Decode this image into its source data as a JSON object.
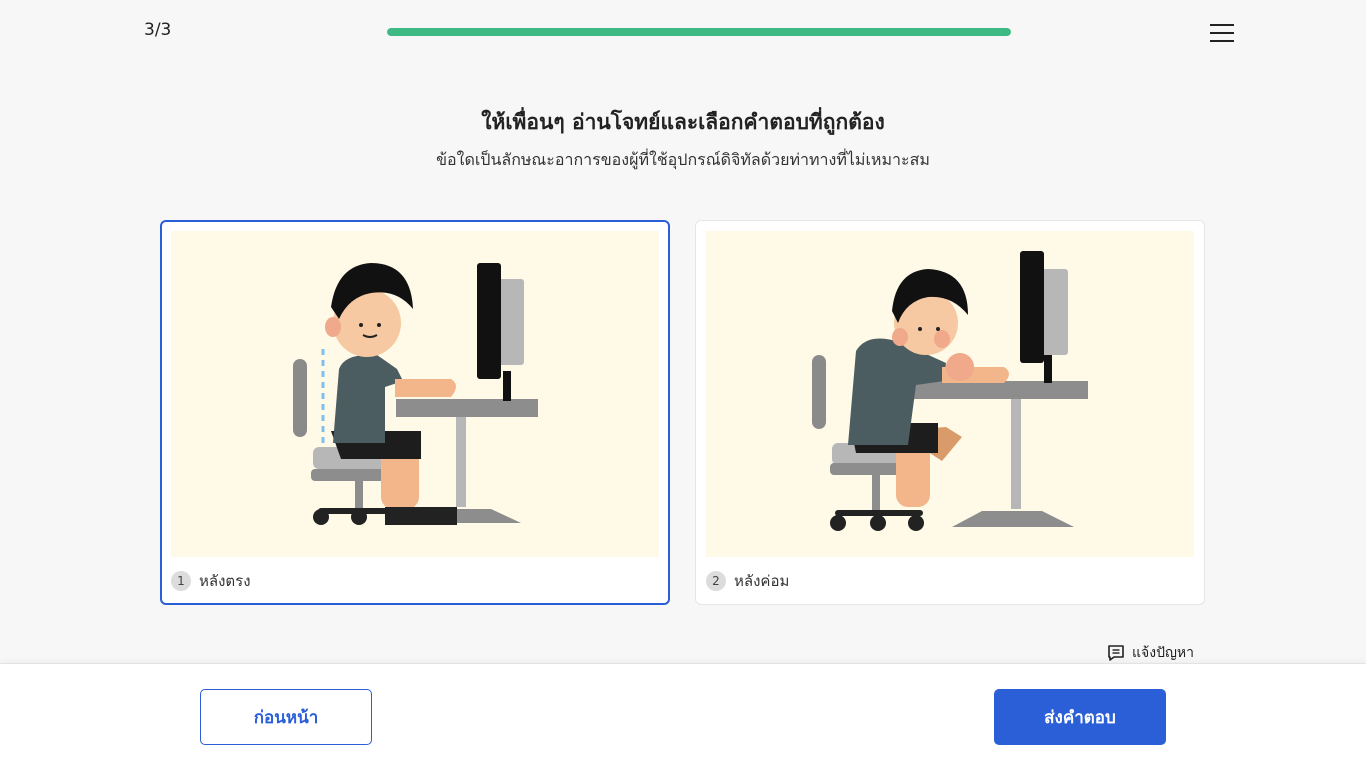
{
  "header": {
    "counter": "3/3",
    "progress": 1.0
  },
  "question": {
    "title": "ให้เพื่อนๆ อ่านโจทย์และเลือกคำตอบที่ถูกต้อง",
    "subtitle": "ข้อใดเป็นลักษณะอาการของผู้ที่ใช้อุปกรณ์ดิจิทัลด้วยท่าทางที่ไม่เหมาะสม"
  },
  "options": [
    {
      "number": "1",
      "label": "หลังตรง",
      "selected": true
    },
    {
      "number": "2",
      "label": "หลังค่อม",
      "selected": false
    }
  ],
  "report": {
    "label": "แจ้งปัญหา"
  },
  "footer": {
    "prev_label": "ก่อนหน้า",
    "submit_label": "ส่งคำตอบ"
  },
  "colors": {
    "accent": "#2a5fd8",
    "progress": "#3dba84",
    "image_bg": "#fff9e8"
  }
}
